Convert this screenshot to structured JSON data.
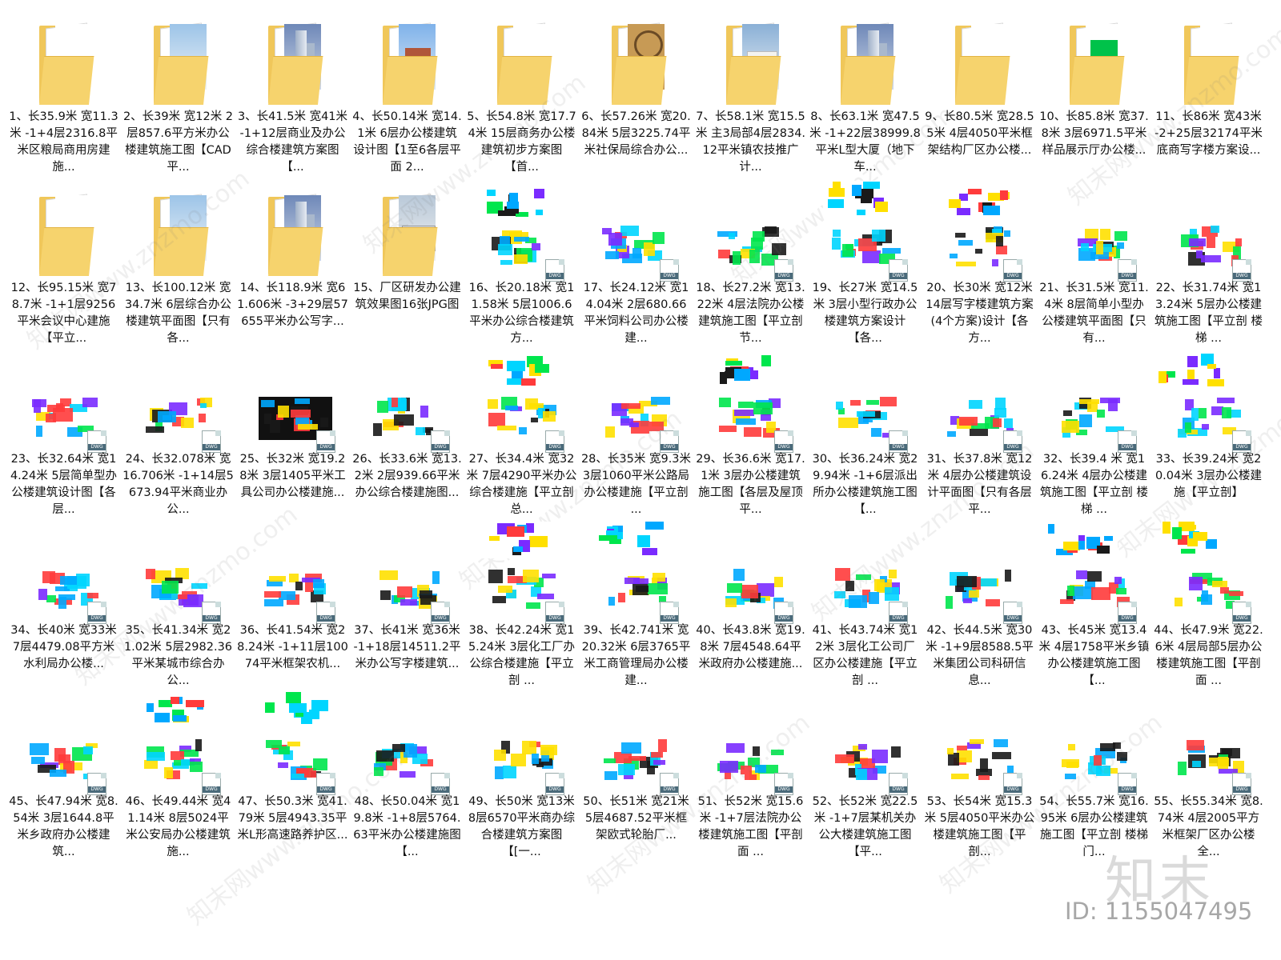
{
  "items": [
    {
      "type": "folder",
      "img": "doc",
      "label": "1、长35.9米 宽11.3米 -1+4层2316.8平米区粮局商用房建施..."
    },
    {
      "type": "folder",
      "img": "house",
      "label": "2、长39米 宽12米 2层857.6平方米办公楼建筑施工图【CAD平..."
    },
    {
      "type": "folder",
      "img": "tower",
      "label": "3、长41.5米 宽41米 -1+12层商业及办公综合楼建筑方案图【..."
    },
    {
      "type": "folder",
      "img": "brick",
      "label": "4、长50.14米 宽14.1米 6层办公楼建筑设计图【1至6各层平面 2..."
    },
    {
      "type": "folder",
      "img": "doc",
      "label": "5、长54.8米 宽17.74米 15层商务办公楼建筑初步方案图【首..."
    },
    {
      "type": "folder",
      "img": "ornate",
      "label": "6、长57.26米 宽20.84米 5层3225.74平米社保局综合办公..."
    },
    {
      "type": "folder",
      "img": "classic",
      "label": "7、长58.1米 宽15.5米 主3局部4层2834.12平米镇农技推广计..."
    },
    {
      "type": "folder",
      "img": "tower",
      "label": "8、长63.1米 宽47.5米 -1+22层38999.8平米L型大厦（地下车..."
    },
    {
      "type": "folder",
      "img": "doc",
      "label": "9、长80.5米 宽28.55米 4层4050平米框架结构厂区办公楼..."
    },
    {
      "type": "folder",
      "img": "plan",
      "label": "10、长85.8米 宽37.8米 3层6971.5平米样品展示厅办公楼..."
    },
    {
      "type": "folder",
      "img": "doc",
      "label": "11、长86米 宽43米 -2+25层32174平米底商写字楼方案设..."
    },
    {
      "type": "folder",
      "img": "doc",
      "label": "12、长95.15米 宽78.7米 -1+1层9256平米会议中心建施【平立..."
    },
    {
      "type": "folder",
      "img": "house",
      "label": "13、长100.12米 宽34.7米 6层综合办公楼建筑平面图【只有各..."
    },
    {
      "type": "folder",
      "img": "tower",
      "label": "14、长118.9米 宽61.606米 -3+29层57655平米办公写字..."
    },
    {
      "type": "folder",
      "img": "modern",
      "label": "15、厂区研发办公建筑效果图16张JPG图"
    },
    {
      "type": "dwg",
      "label": "16、长20.18米 宽11.58米 5层1006.6平米办公综合楼建筑方..."
    },
    {
      "type": "dwg",
      "label": "17、长24.12米 宽14.04米 2层680.66平米饲料公司办公楼建..."
    },
    {
      "type": "dwg",
      "label": "18、长27.2米 宽13.22米 4层法院办公楼建筑施工图【平立剖 节..."
    },
    {
      "type": "dwg",
      "label": "19、长27米 宽14.5米 3层小型行政办公楼建筑方案设计【各..."
    },
    {
      "type": "dwg",
      "label": "20、长30米 宽12米 14层写字楼建筑方案(4个方案)设计【各方..."
    },
    {
      "type": "dwg",
      "label": "21、长31.5米 宽11.4米 8层简单小型办公楼建筑平面图【只有..."
    },
    {
      "type": "dwg",
      "label": "22、长31.74米 宽13.24米 5层办公楼建筑施工图【平立剖 楼梯 ..."
    },
    {
      "type": "dwg",
      "label": "23、长32.64米 宽14.24米 5层简单型办公楼建筑设计图【各层..."
    },
    {
      "type": "dwg",
      "label": "24、长32.078米 宽16.706米 -1+14层5673.94平米商业办公..."
    },
    {
      "type": "dwg",
      "black": true,
      "label": "25、长32米 宽19.28米 3层1405平米工具公司办公楼建施..."
    },
    {
      "type": "dwg",
      "label": "26、长33.6米 宽13.2米 2层939.66平米办公综合楼建施图..."
    },
    {
      "type": "dwg",
      "label": "27、长34.4米 宽32米 7层4290平米办公综合楼建施【平立剖 总..."
    },
    {
      "type": "dwg",
      "label": "28、长35米 宽9.3米 3层1060平米公路局办公楼建施【平立剖 ..."
    },
    {
      "type": "dwg",
      "label": "29、长36.6米 宽17.1米 3层办公楼建筑施工图【各层及屋顶平..."
    },
    {
      "type": "dwg",
      "label": "30、长36.24米 宽29.94米 -1+6层派出所办公楼建筑施工图【..."
    },
    {
      "type": "dwg",
      "label": "31、长37.8米 宽12米 4层办公楼建筑设计平面图【只有各层平..."
    },
    {
      "type": "dwg",
      "label": "32、长39.4 米 宽16.24米 4层办公楼建筑施工图【平立剖 楼梯 ..."
    },
    {
      "type": "dwg",
      "label": "33、长39.24米 宽20.04米 3层办公楼建施【平立剖】"
    },
    {
      "type": "dwg",
      "label": "34、长40米 宽33米 7层4479.08平方米水利局办公楼..."
    },
    {
      "type": "dwg",
      "label": "35、长41.34米 宽21.02米 5层2982.36平米某城市综合办公..."
    },
    {
      "type": "dwg",
      "label": "36、长41.54米 宽28.24米 -1+11层10074平米框架农机..."
    },
    {
      "type": "dwg",
      "label": "37、长41米 宽36米 -1+18层14511.2平米办公写字楼建筑..."
    },
    {
      "type": "dwg",
      "label": "38、长42.24米 宽15.24米 3层化工厂办公综合楼建施【平立剖 ..."
    },
    {
      "type": "dwg",
      "label": "39、长42.741米 宽20.32米 6层3765平米工商管理局办公楼建..."
    },
    {
      "type": "dwg",
      "label": "40、长43.8米 宽19.8米 7层4548.64平米政府办公楼建施..."
    },
    {
      "type": "dwg",
      "label": "41、长43.74米 宽12米 3层化工公司厂区办公楼建施【平立剖 ..."
    },
    {
      "type": "dwg",
      "label": "42、长44.5米 宽30米 -1+9层8588.5平米集团公司科研信息..."
    },
    {
      "type": "dwg",
      "label": "43、长45米 宽13.4米 4层1758平米乡镇办公楼建筑施工图【..."
    },
    {
      "type": "dwg",
      "label": "44、长47.9米 宽22.6米 4层局部5层办公楼建筑施工图【平剖面 ..."
    },
    {
      "type": "dwg",
      "label": "45、长47.94米 宽8.54米 3层1644.8平米乡政府办公楼建筑..."
    },
    {
      "type": "dwg",
      "label": "46、长49.44米 宽41.14米 8层5024平米公安局办公楼建筑施..."
    },
    {
      "type": "dwg",
      "label": "47、长50.3米 宽41.79米 5层4943.35平米L形高速路养护区..."
    },
    {
      "type": "dwg",
      "label": "48、长50.04米 宽19.8米 -1+8层5764.63平米办公楼建施图【..."
    },
    {
      "type": "dwg",
      "label": "49、长50米 宽13米 8层6570平米商办综合楼建筑方案图【[一..."
    },
    {
      "type": "dwg",
      "label": "50、长51米 宽21米 5层4687.52平米框架欧式轮胎厂..."
    },
    {
      "type": "dwg",
      "label": "51、长52米 宽15.6米 -1+7层法院办公楼建筑施工图【平剖面 ..."
    },
    {
      "type": "dwg",
      "label": "52、长52米 宽22.5米 -1+7层某机关办公大楼建筑施工图【平..."
    },
    {
      "type": "dwg",
      "label": "53、长54米 宽15.3米 5层4050平米办公楼建筑施工图【平剖..."
    },
    {
      "type": "dwg",
      "label": "54、长55.7米 宽16.95米 6层办公楼建筑施工图【平立剖 楼梯 门..."
    },
    {
      "type": "dwg",
      "label": "55、长55.34米 宽8.74米 4层2005平方米框架厂区办公楼全..."
    }
  ],
  "dwg_tag": "DWG",
  "watermark": "知末网www.znzmo.com",
  "logo": "知末",
  "id_text": "ID: 1155047495",
  "colors": {
    "folder": "#f0c75a",
    "cad_green": "#00e64d",
    "cad_cyan": "#00e5ff"
  }
}
